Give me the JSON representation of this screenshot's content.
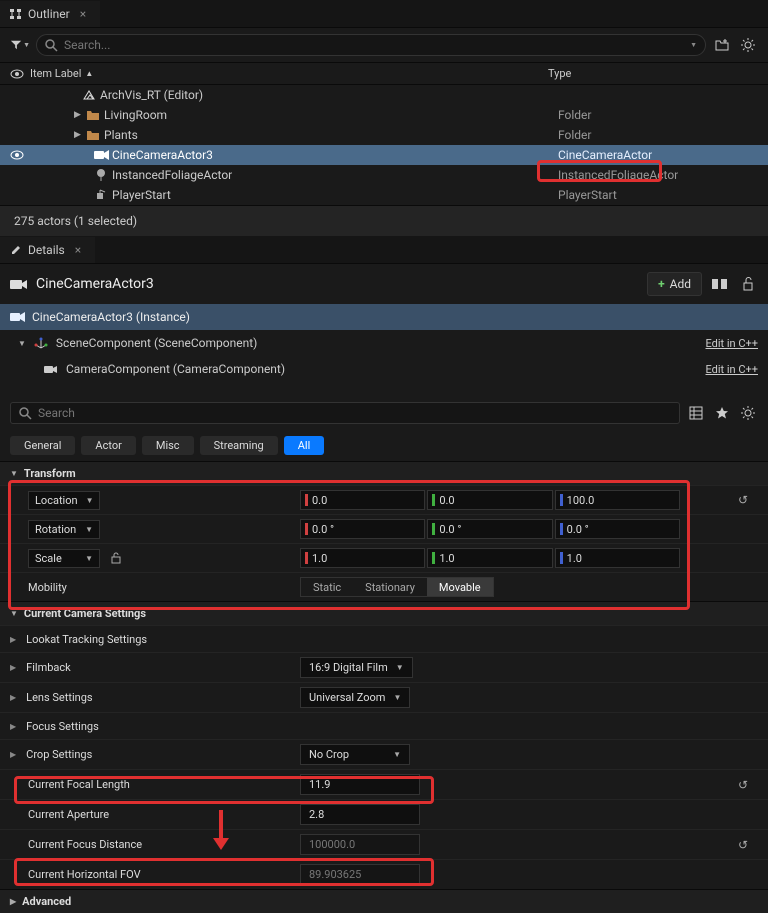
{
  "outliner": {
    "title": "Outliner",
    "search_placeholder": "Search...",
    "columns": {
      "label": "Item Label",
      "type": "Type"
    },
    "rows": [
      {
        "icon": "level",
        "label": "ArchVis_RT (Editor)",
        "type": "",
        "indent": 40,
        "arrow": ""
      },
      {
        "icon": "folder",
        "label": "LivingRoom",
        "type": "Folder",
        "indent": 44,
        "arrow": "▶"
      },
      {
        "icon": "folder",
        "label": "Plants",
        "type": "Folder",
        "indent": 44,
        "arrow": "▶"
      },
      {
        "icon": "camera",
        "label": "CineCameraActor3",
        "type": "CineCameraActor",
        "indent": 52,
        "arrow": "",
        "selected": true
      },
      {
        "icon": "foliage",
        "label": "InstancedFoliageActor",
        "type": "InstancedFoliageActor",
        "indent": 52,
        "arrow": ""
      },
      {
        "icon": "playerstart",
        "label": "PlayerStart",
        "type": "PlayerStart",
        "indent": 52,
        "arrow": ""
      }
    ],
    "status": "275 actors (1 selected)"
  },
  "details": {
    "title": "Details",
    "actor_name": "CineCameraActor3",
    "add_label": "Add",
    "instance_label": "CineCameraActor3 (Instance)",
    "components": [
      {
        "label": "SceneComponent (SceneComponent)",
        "edit": "Edit in C++"
      },
      {
        "label": "CameraComponent (CameraComponent)",
        "edit": "Edit in C++"
      }
    ],
    "search_placeholder": "Search",
    "categories": [
      "General",
      "Actor",
      "Misc",
      "Streaming",
      "All"
    ],
    "active_category": "All",
    "sections": {
      "transform": {
        "title": "Transform",
        "location": {
          "label": "Location",
          "x": "0.0",
          "y": "0.0",
          "z": "100.0"
        },
        "rotation": {
          "label": "Rotation",
          "x": "0.0 °",
          "y": "0.0 °",
          "z": "0.0 °"
        },
        "scale": {
          "label": "Scale",
          "x": "1.0",
          "y": "1.0",
          "z": "1.0"
        },
        "mobility": {
          "label": "Mobility",
          "options": [
            "Static",
            "Stationary",
            "Movable"
          ],
          "active": "Movable"
        }
      },
      "camera": {
        "title": "Current Camera Settings",
        "lookat": "Lookat Tracking Settings",
        "filmback": {
          "label": "Filmback",
          "value": "16:9 Digital Film"
        },
        "lens": {
          "label": "Lens Settings",
          "value": "Universal Zoom"
        },
        "focus": "Focus Settings",
        "crop": {
          "label": "Crop Settings",
          "value": "No Crop"
        },
        "focal_length": {
          "label": "Current Focal Length",
          "value": "11.9"
        },
        "aperture": {
          "label": "Current Aperture",
          "value": "2.8"
        },
        "focus_distance": {
          "label": "Current Focus Distance",
          "value": "100000.0"
        },
        "hfov": {
          "label": "Current Horizontal FOV",
          "value": "89.903625"
        }
      },
      "advanced": "Advanced"
    }
  }
}
